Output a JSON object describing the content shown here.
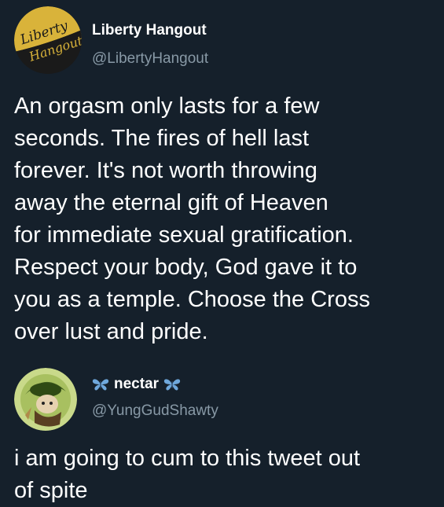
{
  "tweets": [
    {
      "author": {
        "display_name": "Liberty Hangout",
        "handle": "@LibertyHangout",
        "avatar_logo_text": "Liberty Hangout"
      },
      "body_lines": [
        "An orgasm only lasts for a few",
        "seconds. The fires of hell last",
        "forever. It's not worth throwing",
        "away the eternal gift of Heaven",
        "for immediate sexual gratification.",
        "Respect your body, God gave it to",
        "you as a temple. Choose the Cross",
        "over lust and pride."
      ]
    },
    {
      "author": {
        "display_name": "nectar",
        "handle": "@YungGudShawty",
        "name_decoration_icon": "butterfly-icon"
      },
      "body_lines": [
        "i am going to cum to this tweet out",
        "of spite"
      ]
    }
  ],
  "colors": {
    "background": "#15202b",
    "text_primary": "#ffffff",
    "text_secondary": "#8899a6",
    "butterfly": "#6fa8dc"
  }
}
